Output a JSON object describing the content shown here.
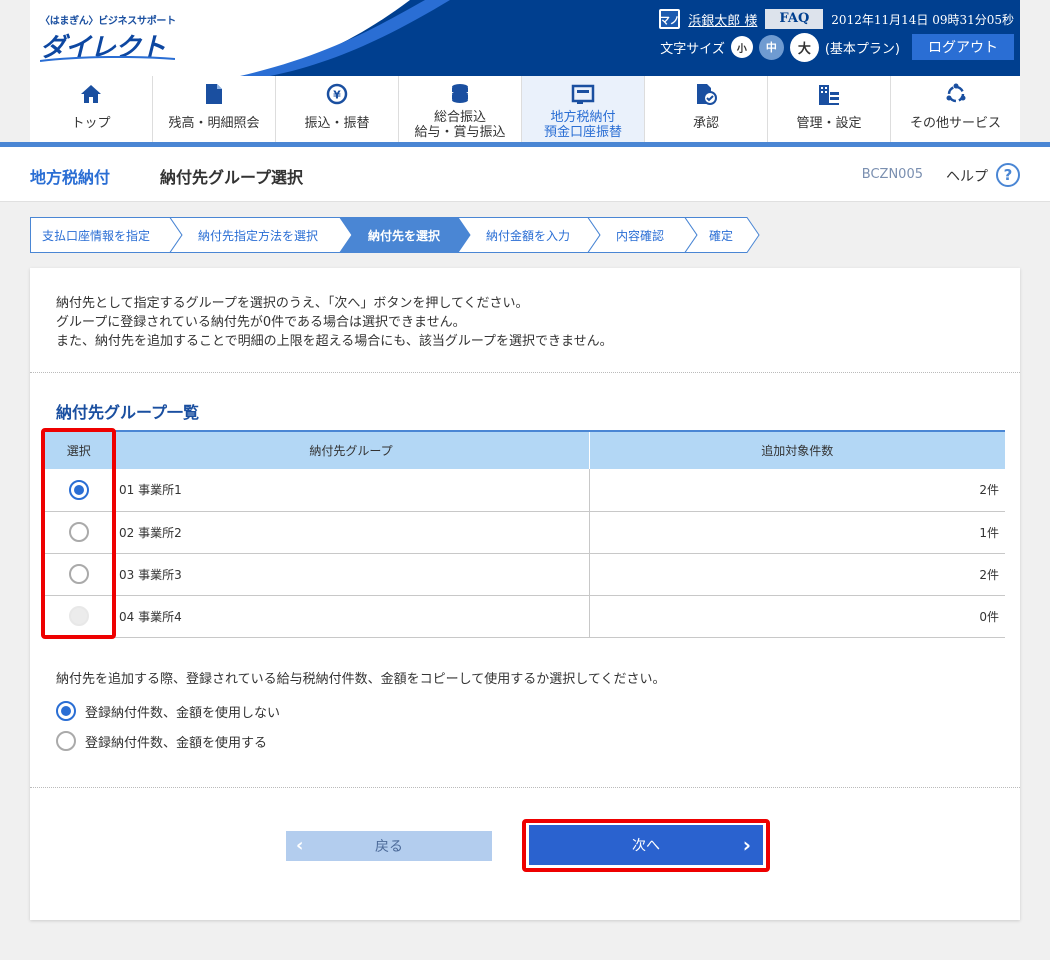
{
  "header": {
    "logo_top": "〈はまぎん〉ビジネスサポート",
    "logo_main": "ダイレクト",
    "user_icon_text": "マノ",
    "user_name": "浜銀太郎 様",
    "faq_label": "FAQ",
    "datetime": "2012年11月14日 09時31分05秒",
    "font_size_label": "文字サイズ",
    "font_small": "小",
    "font_medium": "中",
    "font_large": "大",
    "plan": "(基本プラン)",
    "logout_label": "ログアウト"
  },
  "nav": {
    "items": [
      {
        "label": "トップ",
        "icon": "home-icon"
      },
      {
        "label": "残高・明細照会",
        "icon": "document-icon"
      },
      {
        "label": "振込・振替",
        "icon": "yen-transfer-icon"
      },
      {
        "label_line1": "総合振込",
        "label_line2": "給与・賞与振込",
        "icon": "coins-icon"
      },
      {
        "label_line1": "地方税納付",
        "label_line2": "預金口座振替",
        "icon": "payment-slip-icon"
      },
      {
        "label": "承認",
        "icon": "approval-icon"
      },
      {
        "label": "管理・設定",
        "icon": "settings-building-icon"
      },
      {
        "label": "その他サービス",
        "icon": "services-icon"
      }
    ]
  },
  "titlebar": {
    "main": "地方税納付",
    "sub": "納付先グループ選択",
    "code": "BCZN005",
    "help": "ヘルプ",
    "help_icon": "?"
  },
  "steps": [
    "支払口座情報を指定",
    "納付先指定方法を選択",
    "納付先を選択",
    "納付金額を入力",
    "内容確認",
    "確定"
  ],
  "intro": {
    "line1": "納付先として指定するグループを選択のうえ、「次へ」ボタンを押してください。",
    "line2": "グループに登録されている納付先が0件である場合は選択できません。",
    "line3": "また、納付先を追加することで明細の上限を超える場合にも、該当グループを選択できません。"
  },
  "group_list": {
    "title": "納付先グループ一覧",
    "headers": {
      "select": "選択",
      "group": "納付先グループ",
      "count": "追加対象件数"
    },
    "rows": [
      {
        "group": "01 事業所1",
        "count": "2件",
        "state": "selected"
      },
      {
        "group": "02 事業所2",
        "count": "1件",
        "state": "unselected"
      },
      {
        "group": "03 事業所3",
        "count": "2件",
        "state": "unselected"
      },
      {
        "group": "04 事業所4",
        "count": "0件",
        "state": "disabled"
      }
    ]
  },
  "copy_option": {
    "question": "納付先を追加する際、登録されている給与税納付件数、金額をコピーして使用するか選択してください。",
    "options": [
      {
        "label": "登録納付件数、金額を使用しない",
        "selected": true
      },
      {
        "label": "登録納付件数、金額を使用する",
        "selected": false
      }
    ]
  },
  "buttons": {
    "back": "戻る",
    "next": "次へ"
  },
  "colors": {
    "brand_navy": "#003f8f",
    "accent_blue": "#2a6ed4",
    "table_header": "#b3d7f5",
    "highlight_red": "#e00000"
  }
}
